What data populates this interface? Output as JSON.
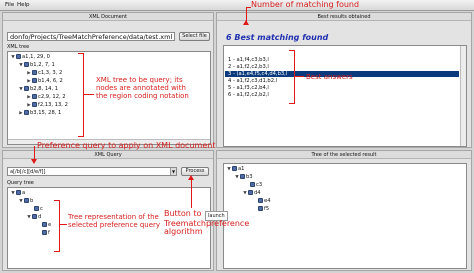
{
  "menu": {
    "file": "File",
    "help": "Help"
  },
  "xml_document": {
    "title": "XML Document",
    "path": "donfo/Projects/TreeMatchPreference/data/test.xml",
    "select_button": "Select file",
    "tree_label": "XML tree",
    "tree": [
      {
        "label": "a1,1, 29, 0"
      },
      {
        "label": "b1,2, 7, 1"
      },
      {
        "label": "c1,3, 3, 2"
      },
      {
        "label": "b1,4, 6, 2"
      },
      {
        "label": "b2,8, 14, 1"
      },
      {
        "label": "c2,9, 12, 2"
      },
      {
        "label": "f2,13, 13, 2"
      },
      {
        "label": "b3,15, 28, 1"
      }
    ]
  },
  "best_results": {
    "title": "Best results obtained",
    "heading": "6 Best matching found",
    "items": [
      {
        "text": "1 - a1,f4,c3,b3,l",
        "selected": false
      },
      {
        "text": "2 - a1,f2,c2,b3,l",
        "selected": false
      },
      {
        "text": "3 - (a1,e4,f5,c4,d4,b3,l",
        "selected": true
      },
      {
        "text": "4 - a1,f2,c3,d1,b2,l",
        "selected": false
      },
      {
        "text": "5 - a1,f3,c2,b4,l",
        "selected": false
      },
      {
        "text": "6 - a1,f2,c2,b2,l",
        "selected": false
      }
    ]
  },
  "xml_query": {
    "title": "XML Query",
    "query_value": "a[/b[/c][d/e/f]]",
    "process_button": "Process",
    "tree_label": "Query tree",
    "tree": [
      {
        "label": "a"
      },
      {
        "label": "b"
      },
      {
        "label": "c"
      },
      {
        "label": "d"
      },
      {
        "label": "e"
      },
      {
        "label": "f"
      }
    ]
  },
  "selected_result_tree": {
    "title": "Tree of the selected result",
    "tree": [
      {
        "label": "a1"
      },
      {
        "label": "b3"
      },
      {
        "label": "c3"
      },
      {
        "label": "d4"
      },
      {
        "label": "e4"
      },
      {
        "label": "f5"
      }
    ]
  },
  "annotations": {
    "number_matching": "Number of matching found",
    "xml_tree_note": [
      "XML tree to be query; its",
      "nodes are annotated with",
      "the region coding notation"
    ],
    "best_answers": "Best answers",
    "preference_query": "Preference query to apply on XML document",
    "tree_repr": [
      "Tree representation of the",
      "selected preference query"
    ],
    "button_to": "Button to",
    "launch": "launch",
    "algorithm": [
      "Treematchpreference",
      "algorithm"
    ]
  },
  "colors": {
    "annotation": "#e01818",
    "heading": "#2030b0",
    "selection": "#0a3a7c"
  }
}
